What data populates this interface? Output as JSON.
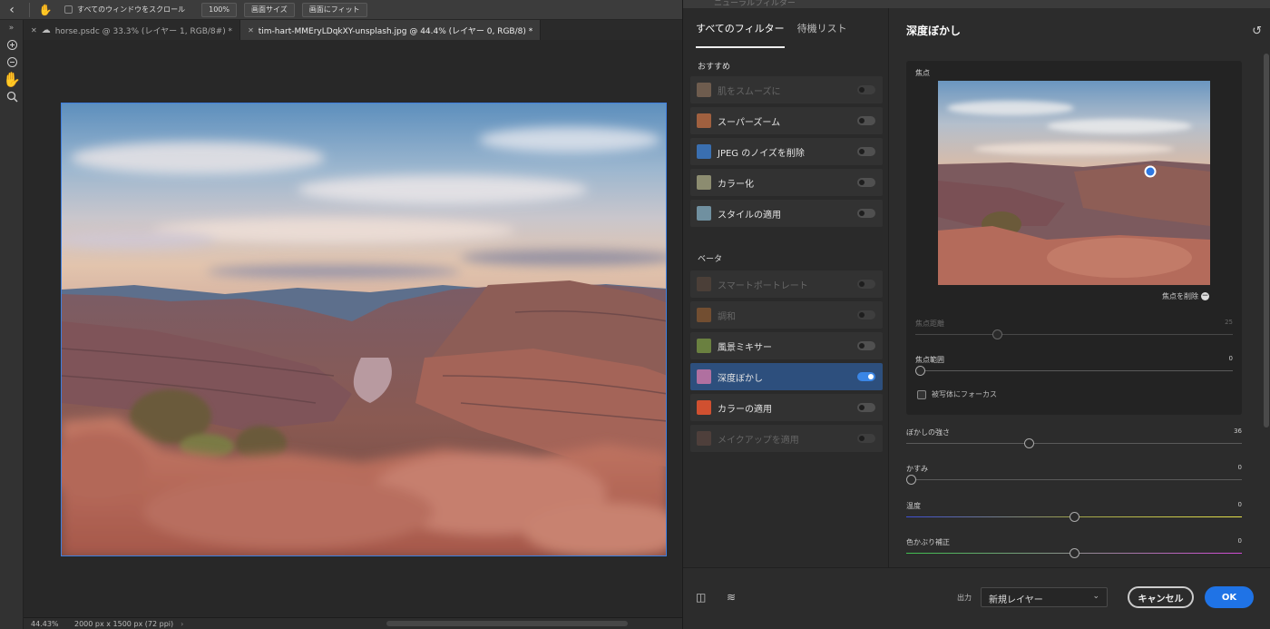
{
  "options_bar": {
    "scroll_all_label": "すべてのウィンドウをスクロール",
    "zoom_100": "100%",
    "fit_screen_size": "画面サイズ",
    "fit_screen": "画面にフィット"
  },
  "tabs": [
    {
      "label": "horse.psdc @ 33.3% (レイヤー 1, RGB/8#) *"
    },
    {
      "label": "tim-hart-MMEryLDqkXY-unsplash.jpg @ 44.4% (レイヤー 0, RGB/8) *"
    }
  ],
  "status": {
    "zoom": "44.43%",
    "doc_size": "2000 px x 1500 px (72 ppi)"
  },
  "neural_filters": {
    "window_title": "ニューラルフィルター",
    "tabs": {
      "all": "すべてのフィルター",
      "waitlist": "待機リスト"
    },
    "featured_title": "おすすめ",
    "featured": [
      {
        "label": "肌をスムーズに",
        "thumb": "#b89070",
        "enabled": false
      },
      {
        "label": "スーパーズーム",
        "thumb": "#a0603f",
        "enabled": true
      },
      {
        "label": "JPEG のノイズを削除",
        "thumb": "#3a6fb0",
        "enabled": true
      },
      {
        "label": "カラー化",
        "thumb": "#8c8c70",
        "enabled": true
      },
      {
        "label": "スタイルの適用",
        "thumb": "#7090a0",
        "enabled": true
      }
    ],
    "beta_title": "ベータ",
    "beta": [
      {
        "label": "スマートポートレート",
        "thumb": "#6a5040",
        "enabled": false
      },
      {
        "label": "調和",
        "thumb": "#c07030",
        "enabled": false
      },
      {
        "label": "風景ミキサー",
        "thumb": "#6a8040",
        "enabled": true
      },
      {
        "label": "深度ぼかし",
        "thumb": "#b070a0",
        "enabled": true,
        "selected": true,
        "on": true
      },
      {
        "label": "カラーの適用",
        "thumb": "#d05030",
        "enabled": true
      },
      {
        "label": "メイクアップを適用",
        "thumb": "#705048",
        "enabled": false
      }
    ]
  },
  "depth_blur": {
    "title": "深度ぼかし",
    "focal_point_label": "焦点",
    "remove_focal_point": "焦点を削除",
    "focal_distance": {
      "label": "焦点距離",
      "value": "25"
    },
    "focal_range": {
      "label": "焦点範囲",
      "value": "0"
    },
    "focus_subject": "被写体にフォーカス",
    "blur_strength": {
      "label": "ぼかしの強さ",
      "value": "36"
    },
    "haze": {
      "label": "かすみ",
      "value": "0"
    },
    "warmth": {
      "label": "温度",
      "value": "0"
    },
    "tint": {
      "label": "色かぶり補正",
      "value": "0"
    }
  },
  "footer": {
    "output_label": "出力",
    "output_value": "新規レイヤー",
    "cancel": "キャンセル",
    "ok": "OK"
  }
}
